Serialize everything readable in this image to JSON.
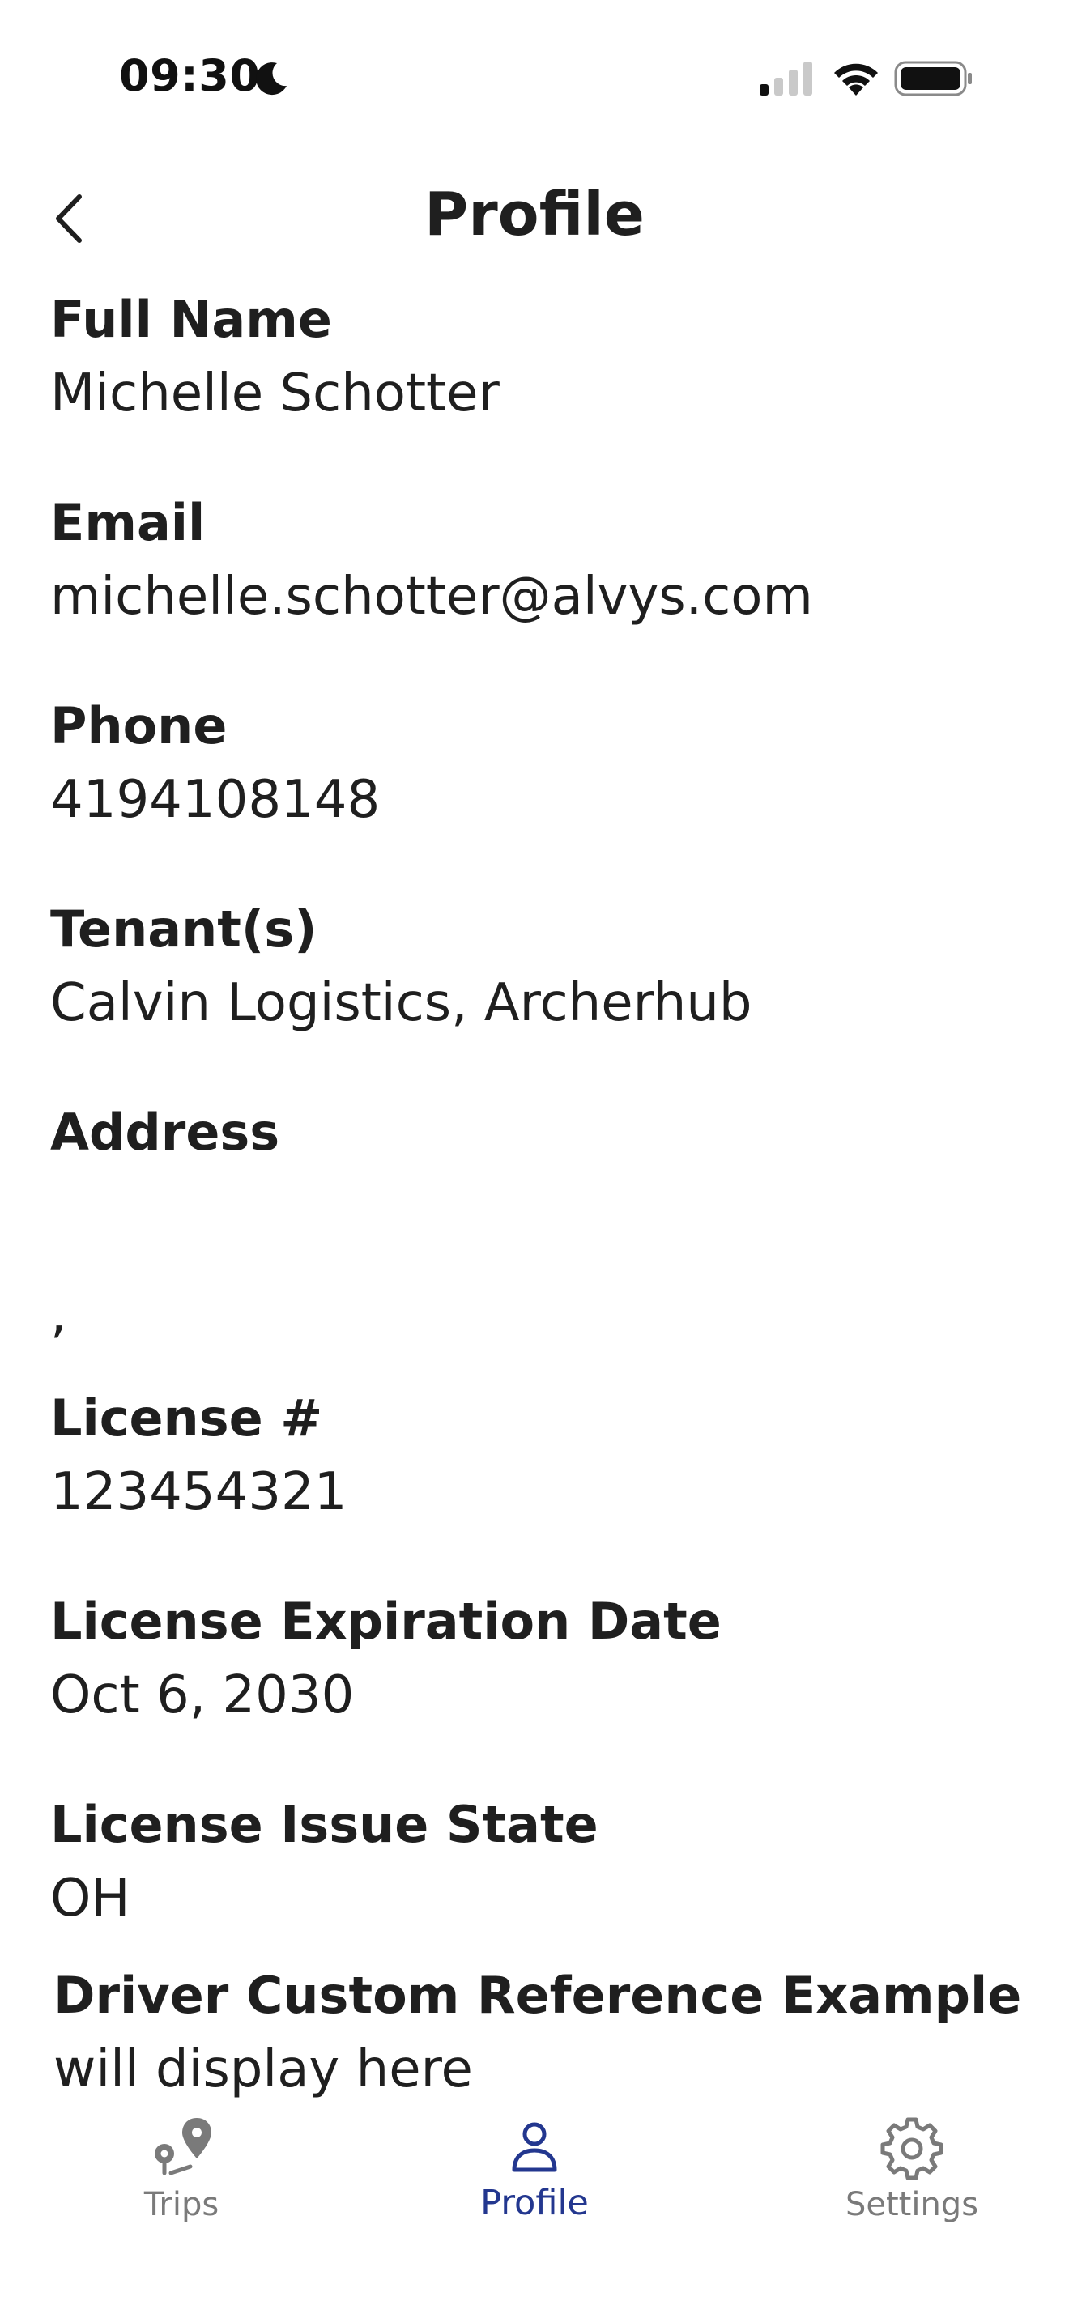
{
  "status_bar": {
    "time": "09:30",
    "icons": [
      "moon-icon",
      "signal-icon",
      "wifi-icon",
      "battery-icon"
    ]
  },
  "header": {
    "title": "Profile",
    "back_icon": "chevron-left-icon"
  },
  "fields": [
    {
      "label": "Full Name",
      "value": "Michelle Schotter"
    },
    {
      "label": "Email",
      "value": "michelle.schotter@alvys.com"
    },
    {
      "label": "Phone",
      "value": "4194108148"
    },
    {
      "label": "Tenant(s)",
      "value": "Calvin Logistics, Archerhub"
    },
    {
      "label": "Address",
      "value": ""
    },
    {
      "label": "",
      "value": ","
    },
    {
      "label": "License #",
      "value": "123454321"
    },
    {
      "label": "License Expiration Date",
      "value": "Oct 6, 2030"
    },
    {
      "label": "License Issue State",
      "value": "OH"
    },
    {
      "label": "Driver Custom Reference Example",
      "value": "will display here"
    }
  ],
  "bottom_nav": {
    "items": [
      {
        "label": "Trips",
        "icon": "map-pin-icon",
        "active": false
      },
      {
        "label": "Profile",
        "icon": "person-icon",
        "active": true
      },
      {
        "label": "Settings",
        "icon": "gear-icon",
        "active": false
      }
    ]
  },
  "colors": {
    "text": "#1f1f1f",
    "accent": "#23378f",
    "inactive": "#7a7a7a"
  }
}
